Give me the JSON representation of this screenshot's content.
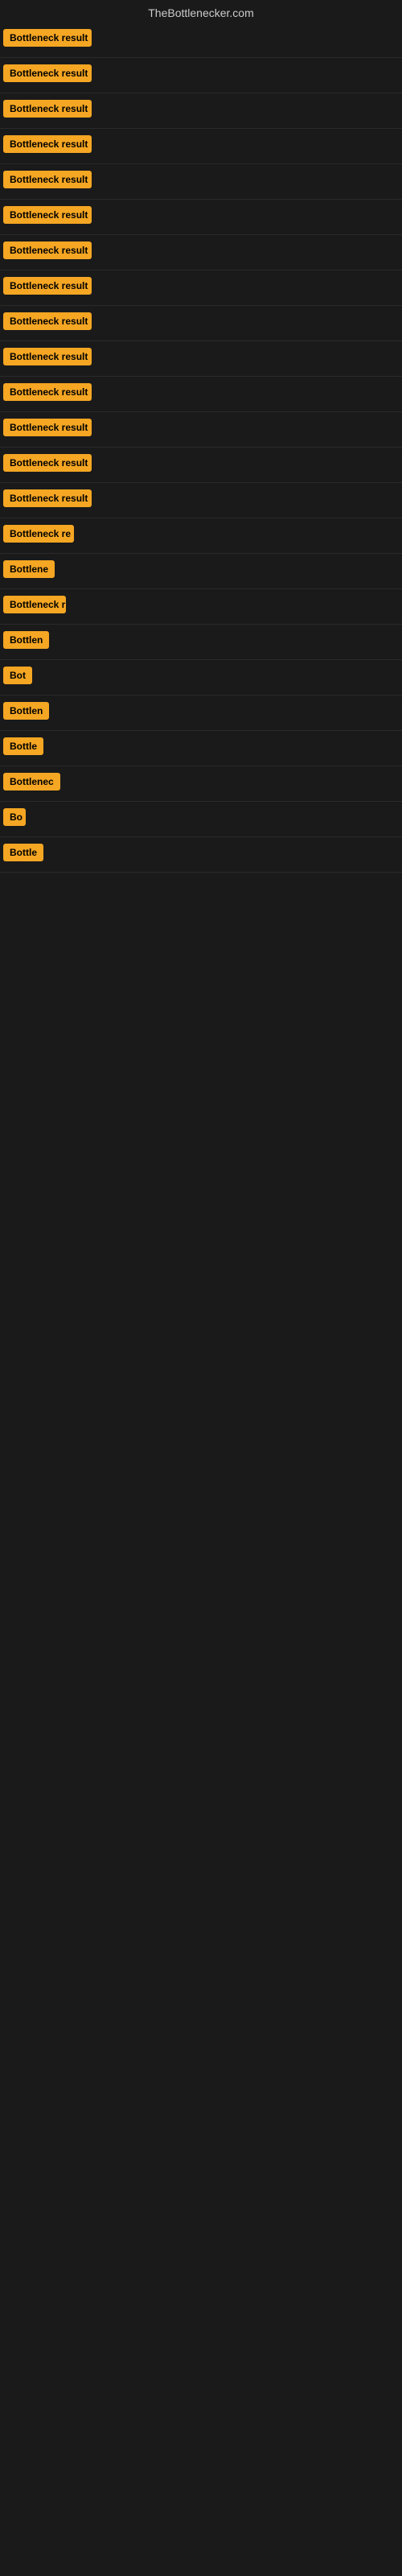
{
  "site": {
    "title": "TheBottlenecker.com"
  },
  "rows": [
    {
      "id": 1,
      "label": "Bottleneck result",
      "width": 110
    },
    {
      "id": 2,
      "label": "Bottleneck result",
      "width": 110
    },
    {
      "id": 3,
      "label": "Bottleneck result",
      "width": 110
    },
    {
      "id": 4,
      "label": "Bottleneck result",
      "width": 110
    },
    {
      "id": 5,
      "label": "Bottleneck result",
      "width": 110
    },
    {
      "id": 6,
      "label": "Bottleneck result",
      "width": 110
    },
    {
      "id": 7,
      "label": "Bottleneck result",
      "width": 110
    },
    {
      "id": 8,
      "label": "Bottleneck result",
      "width": 110
    },
    {
      "id": 9,
      "label": "Bottleneck result",
      "width": 110
    },
    {
      "id": 10,
      "label": "Bottleneck result",
      "width": 110
    },
    {
      "id": 11,
      "label": "Bottleneck result",
      "width": 110
    },
    {
      "id": 12,
      "label": "Bottleneck result",
      "width": 110
    },
    {
      "id": 13,
      "label": "Bottleneck result",
      "width": 110
    },
    {
      "id": 14,
      "label": "Bottleneck result",
      "width": 110
    },
    {
      "id": 15,
      "label": "Bottleneck re",
      "width": 88
    },
    {
      "id": 16,
      "label": "Bottlene",
      "width": 68
    },
    {
      "id": 17,
      "label": "Bottleneck r",
      "width": 78
    },
    {
      "id": 18,
      "label": "Bottlen",
      "width": 58
    },
    {
      "id": 19,
      "label": "Bot",
      "width": 38
    },
    {
      "id": 20,
      "label": "Bottlen",
      "width": 58
    },
    {
      "id": 21,
      "label": "Bottle",
      "width": 50
    },
    {
      "id": 22,
      "label": "Bottlenec",
      "width": 72
    },
    {
      "id": 23,
      "label": "Bo",
      "width": 28
    },
    {
      "id": 24,
      "label": "Bottle",
      "width": 50
    }
  ],
  "colors": {
    "badge_bg": "#f5a623",
    "badge_text": "#000000",
    "background": "#1a1a1a",
    "title_color": "#cccccc",
    "border_color": "#2a2a2a"
  }
}
